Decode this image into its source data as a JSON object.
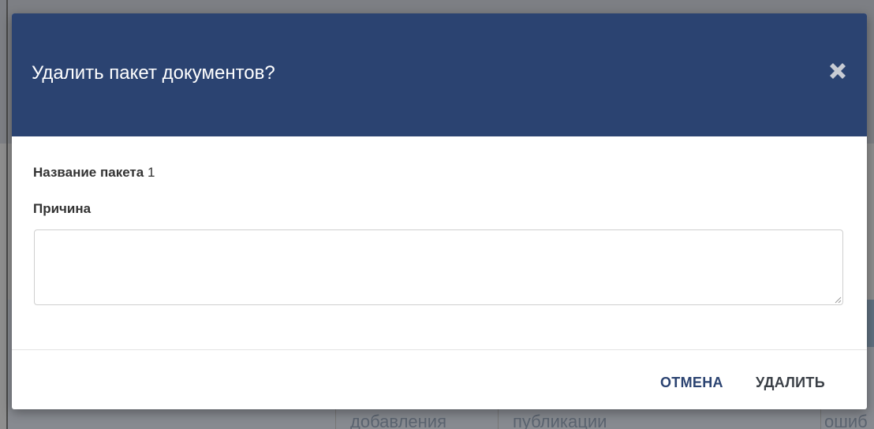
{
  "background": {
    "cells": [
      "добавления",
      "публикации",
      "ошиб"
    ]
  },
  "modal": {
    "title": "Удалить пакет документов?",
    "close_icon": "close-icon",
    "package_label": "Название пакета",
    "package_value": "1",
    "reason_label": "Причина",
    "reason_value": "",
    "cancel_label": "ОТМЕНА",
    "delete_label": "УДАЛИТЬ"
  },
  "colors": {
    "header": "#2b4371",
    "cancel_text": "#2b4371",
    "delete_text": "#3a3f46"
  }
}
